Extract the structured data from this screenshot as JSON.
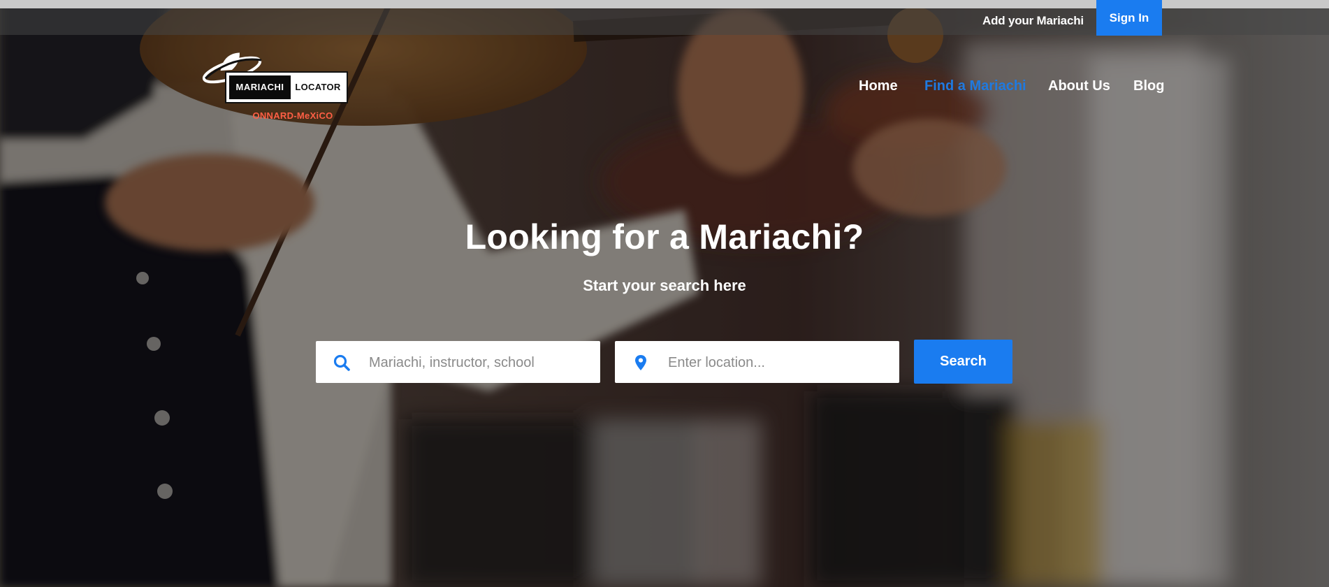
{
  "topbar": {
    "add_link": "Add your Mariachi",
    "signin_label": "Sign In"
  },
  "logo": {
    "left_text": "MARIACHI",
    "right_text": "LOCATOR",
    "subtitle": "ONNARD-MeXiCO"
  },
  "nav": {
    "items": [
      {
        "label": "Home",
        "active": false
      },
      {
        "label": "Find a Mariachi",
        "active": true
      },
      {
        "label": "About Us",
        "active": false
      },
      {
        "label": "Blog",
        "active": false
      }
    ]
  },
  "hero": {
    "title": "Looking for a Mariachi?",
    "subtitle": "Start your search here"
  },
  "search": {
    "keyword_placeholder": "Mariachi, instructor, school",
    "keyword_value": "",
    "location_placeholder": "Enter location...",
    "location_value": "",
    "button_label": "Search",
    "keyword_icon": "search-icon",
    "location_icon": "map-pin-icon"
  },
  "colors": {
    "accent": "#1a7cf0",
    "nav_active": "#1f7ae0",
    "logo_subtitle": "#ff5f45"
  }
}
